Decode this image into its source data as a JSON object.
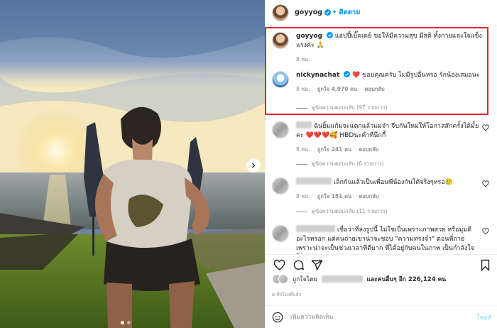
{
  "header": {
    "username": "goyyog",
    "follow_label": "• ติดตาม"
  },
  "caption": {
    "username": "goyyog",
    "text": "แฮปปี้เบิ๊ดเดย์ ขอให้มีความสุข มีสติ ทั้งกายและใจแข็งแรงค่ะ 🙏",
    "time": "8 ชม."
  },
  "comments": [
    {
      "username": "nickynachat",
      "text": "❤️ ขอบคุณครับ ไม่มีรูปอื่นหรอ รักน้องเสมอนะ",
      "time": "8 ชม.",
      "likes": "ถูกใจ 4,970 คน",
      "reply": "ตอบกลับ",
      "view_replies": "ดูข้อความตอบกลับ (97 รายการ)"
    },
    {
      "username": "",
      "text": "ฉันยิ้มแก้มจะแตกแล้วแม่จ๋า จีบกันใหม่ให้โอกาสสักครั้งได้มั้ยคะ ❤️❤️❤️🥰 HBDนะคำที่นึกกี้",
      "time": "8 ชม.",
      "likes": "ถูกใจ 241 คน",
      "reply": "ตอบกลับ",
      "view_replies": "ดูข้อความตอบกลับ (6 รายการ)"
    },
    {
      "username": "",
      "text": "เลิกกันแล้วเป็นเพื่อนพี่น้องกันได้จริงๆหรอ🥲",
      "time": "8 ชม.",
      "likes": "ถูกใจ 151 คน",
      "reply": "ตอบกลับ",
      "view_replies": "ดูข้อความตอบกลับ (11 รายการ)"
    },
    {
      "username": "",
      "text": "เชื่อว่าที่ลงรูปนี้ ไม่ใช่เป็นเพราะภาพสวย หรือมุมดีอะไรหรอก แต่คนถ่ายเขาน่าจะชอบ \"ความทรงจำ\" ตอนที่ถ่าย เพราะน่าจะเป็นช่วงเวลาที่ดีมาก ที่ได้อยู่กับคนในภาพ เป็นกำลังใจให้ทุก",
      "time": "",
      "likes": "",
      "reply": "",
      "view_replies": ""
    }
  ],
  "likes_summary": {
    "prefix": "ถูกใจโดย",
    "suffix": "และคนอื่นๆ อีก 226,124 คน"
  },
  "time_ago": "8 ชั่วโมงที่แล้ว",
  "add_comment": {
    "placeholder": "เพิ่มความคิดเห็น",
    "post_label": "โพสต์"
  },
  "icons": [
    "heart-icon",
    "comment-icon",
    "share-icon",
    "bookmark-icon",
    "emoji-icon",
    "verified-icon",
    "chevron-right-icon"
  ],
  "colors": {
    "accent": "#0095f6",
    "highlight": "#e3232f",
    "muted": "#8e8e8e"
  }
}
